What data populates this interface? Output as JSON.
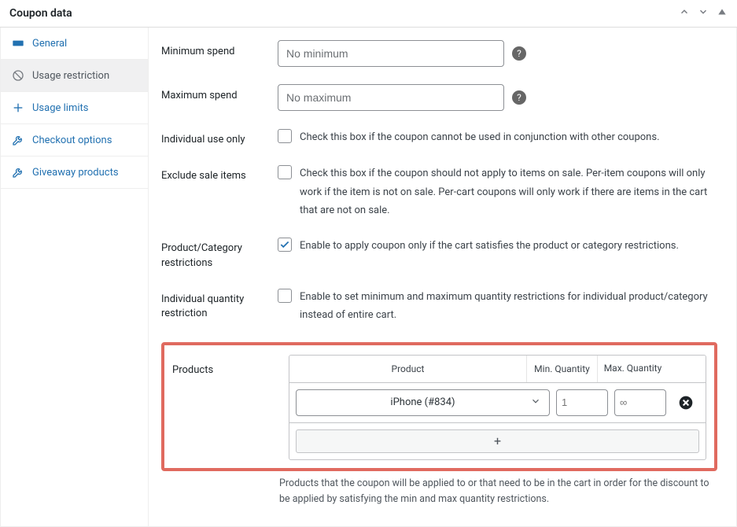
{
  "panel": {
    "title": "Coupon data"
  },
  "sidebar": {
    "items": [
      {
        "label": "General"
      },
      {
        "label": "Usage restriction"
      },
      {
        "label": "Usage limits"
      },
      {
        "label": "Checkout options"
      },
      {
        "label": "Giveaway products"
      }
    ]
  },
  "fields": {
    "minimum_spend": {
      "label": "Minimum spend",
      "placeholder": "No minimum"
    },
    "maximum_spend": {
      "label": "Maximum spend",
      "placeholder": "No maximum"
    },
    "individual_use": {
      "label": "Individual use only",
      "text": "Check this box if the coupon cannot be used in conjunction with other coupons."
    },
    "exclude_sale": {
      "label": "Exclude sale items",
      "text": "Check this box if the coupon should not apply to items on sale. Per-item coupons will only work if the item is not on sale. Per-cart coupons will only work if there are items in the cart that are not on sale."
    },
    "pc_restrictions": {
      "label": "Product/Category restrictions",
      "text": "Enable to apply coupon only if the cart satisfies the product or category restrictions."
    },
    "indiv_qty": {
      "label": "Individual quantity restriction",
      "text": "Enable to set minimum and maximum quantity restrictions for individual product/category instead of entire cart."
    },
    "products": {
      "label": "Products",
      "header_product": "Product",
      "header_min": "Min. Quantity",
      "header_max": "Max. Quantity",
      "row": {
        "selected": "iPhone (#834)",
        "min_placeholder": "1",
        "max_placeholder": "∞"
      },
      "add_label": "+",
      "helper": "Products that the coupon will be applied to or that need to be in the cart in order for the discount to be applied by satisfying the min and max quantity restrictions."
    }
  }
}
